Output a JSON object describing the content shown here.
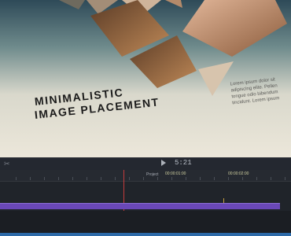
{
  "viewer": {
    "title_line1": "MINIMALISTIC",
    "title_line2": "IMAGE PLACEMENT",
    "lorem_lines": [
      "Lorem ipsum dolor sit",
      "adipiscing elite. Pellen",
      "tongue odio bibendum",
      "tincidunt. Lorem ipsum"
    ]
  },
  "toolbar": {
    "left_icon": "scissors-icon",
    "timecode": "5:21"
  },
  "timeline": {
    "project_label": "Project",
    "ruler_labels": [
      "00:00:01:00",
      "00:00:02:00"
    ],
    "colors": {
      "clip": "#6a48b8",
      "playhead": "#c43c3c",
      "bottom_clip": "#2d6aa8"
    }
  }
}
